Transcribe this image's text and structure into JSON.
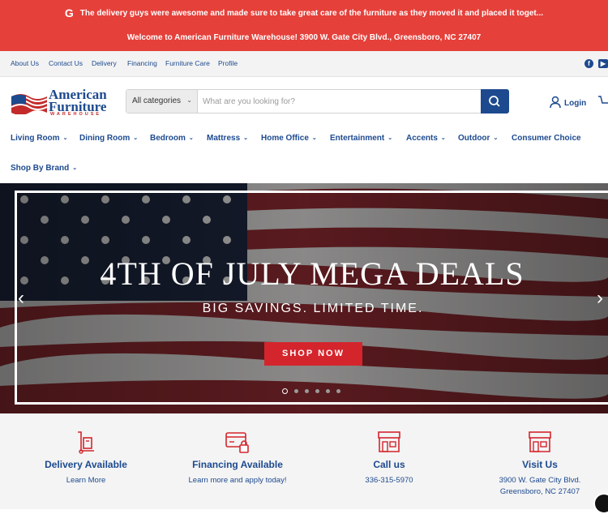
{
  "announcement": {
    "review_icon": "google-g-icon",
    "review_text": "The delivery guys were awesome and made sure to take great care of the furniture as they moved it and placed it toget...",
    "welcome_text": "Welcome to American Furniture Warehouse! 3900 W. Gate City Blvd., Greensboro, NC 27407"
  },
  "utility_nav": {
    "links": [
      "About Us",
      "Contact Us",
      "Delivery",
      "Financing",
      "Furniture Care",
      "Profile"
    ],
    "social_icons": [
      "facebook-icon",
      "youtube-icon"
    ]
  },
  "logo": {
    "line1": "American",
    "line2": "Furniture",
    "line3": "WAREHOUSE"
  },
  "search": {
    "category_label": "All categories",
    "placeholder": "What are you looking for?",
    "value": ""
  },
  "account": {
    "login_label": "Login"
  },
  "main_nav": {
    "items": [
      {
        "label": "Living Room",
        "dropdown": true
      },
      {
        "label": "Dining Room",
        "dropdown": true
      },
      {
        "label": "Bedroom",
        "dropdown": true
      },
      {
        "label": "Mattress",
        "dropdown": true
      },
      {
        "label": "Home Office",
        "dropdown": true
      },
      {
        "label": "Entertainment",
        "dropdown": true
      },
      {
        "label": "Accents",
        "dropdown": true
      },
      {
        "label": "Outdoor",
        "dropdown": true
      },
      {
        "label": "Consumer Choice",
        "dropdown": false
      },
      {
        "label": "Shop By Brand",
        "dropdown": true
      }
    ]
  },
  "hero": {
    "headline": "4TH OF JULY MEGA DEALS",
    "subheadline": "BIG SAVINGS. LIMITED TIME.",
    "cta_label": "SHOP NOW",
    "slide_count": 6,
    "active_slide": 1
  },
  "features": [
    {
      "icon": "delivery-dolly-icon",
      "title": "Delivery Available",
      "lines": [
        "Learn More"
      ]
    },
    {
      "icon": "credit-card-lock-icon",
      "title": "Financing Available",
      "lines": [
        "Learn more and apply today!"
      ]
    },
    {
      "icon": "storefront-icon",
      "title": "Call us",
      "lines": [
        "336-315-5970"
      ]
    },
    {
      "icon": "storefront-icon",
      "title": "Visit Us",
      "lines": [
        "3900 W. Gate City Blvd.",
        "Greensboro, NC 27407"
      ]
    }
  ],
  "colors": {
    "brand_blue": "#1d4a8f",
    "announcement_red": "#e5403a",
    "cta_red": "#d4252d"
  }
}
